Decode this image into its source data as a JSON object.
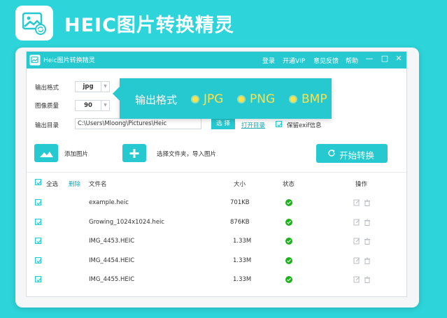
{
  "hero": {
    "title": "HEIC图片转换精灵"
  },
  "window": {
    "title": "Heic图片转换精灵",
    "menu": [
      {
        "label": "登录"
      },
      {
        "label": "开通VIP"
      },
      {
        "label": "意见反馈"
      },
      {
        "label": "帮助"
      }
    ],
    "controls": {
      "minimize": "—",
      "maximize": "□",
      "close": "✕"
    }
  },
  "settings": {
    "format_label": "输出格式",
    "format_value": "jpg",
    "quality_label": "图像质量",
    "quality_value": "90",
    "dir_label": "输出目录",
    "dir_value": "C:\\Users\\Mloong\\Pictures\\Heic",
    "select_btn": "选 择",
    "open_dir": "打开目录",
    "keep_exif": "保留exif信息"
  },
  "tooltip": {
    "label": "输出格式",
    "options": [
      "JPG",
      "PNG",
      "BMP"
    ]
  },
  "actions": {
    "add_image": "添加图片",
    "add_folder": "选择文件夹，导入图片",
    "convert": "开始转换"
  },
  "table": {
    "select_all": "全选",
    "delete": "删除",
    "col_name": "文件名",
    "col_size": "大小",
    "col_status": "状态",
    "col_ops": "操作",
    "rows": [
      {
        "name": "example.heic",
        "size": "701KB"
      },
      {
        "name": "Growing_1024x1024.heic",
        "size": "876KB"
      },
      {
        "name": "IMG_4453.HEIC",
        "size": "1.33M"
      },
      {
        "name": "IMG_4454.HEIC",
        "size": "1.33M"
      },
      {
        "name": "IMG_4455.HEIC",
        "size": "1.33M"
      }
    ]
  },
  "colors": {
    "accent": "#25c9cf",
    "background": "#2dd4d9",
    "tooltip_text": "#ffe14a",
    "status_ok": "#1ab41a"
  }
}
